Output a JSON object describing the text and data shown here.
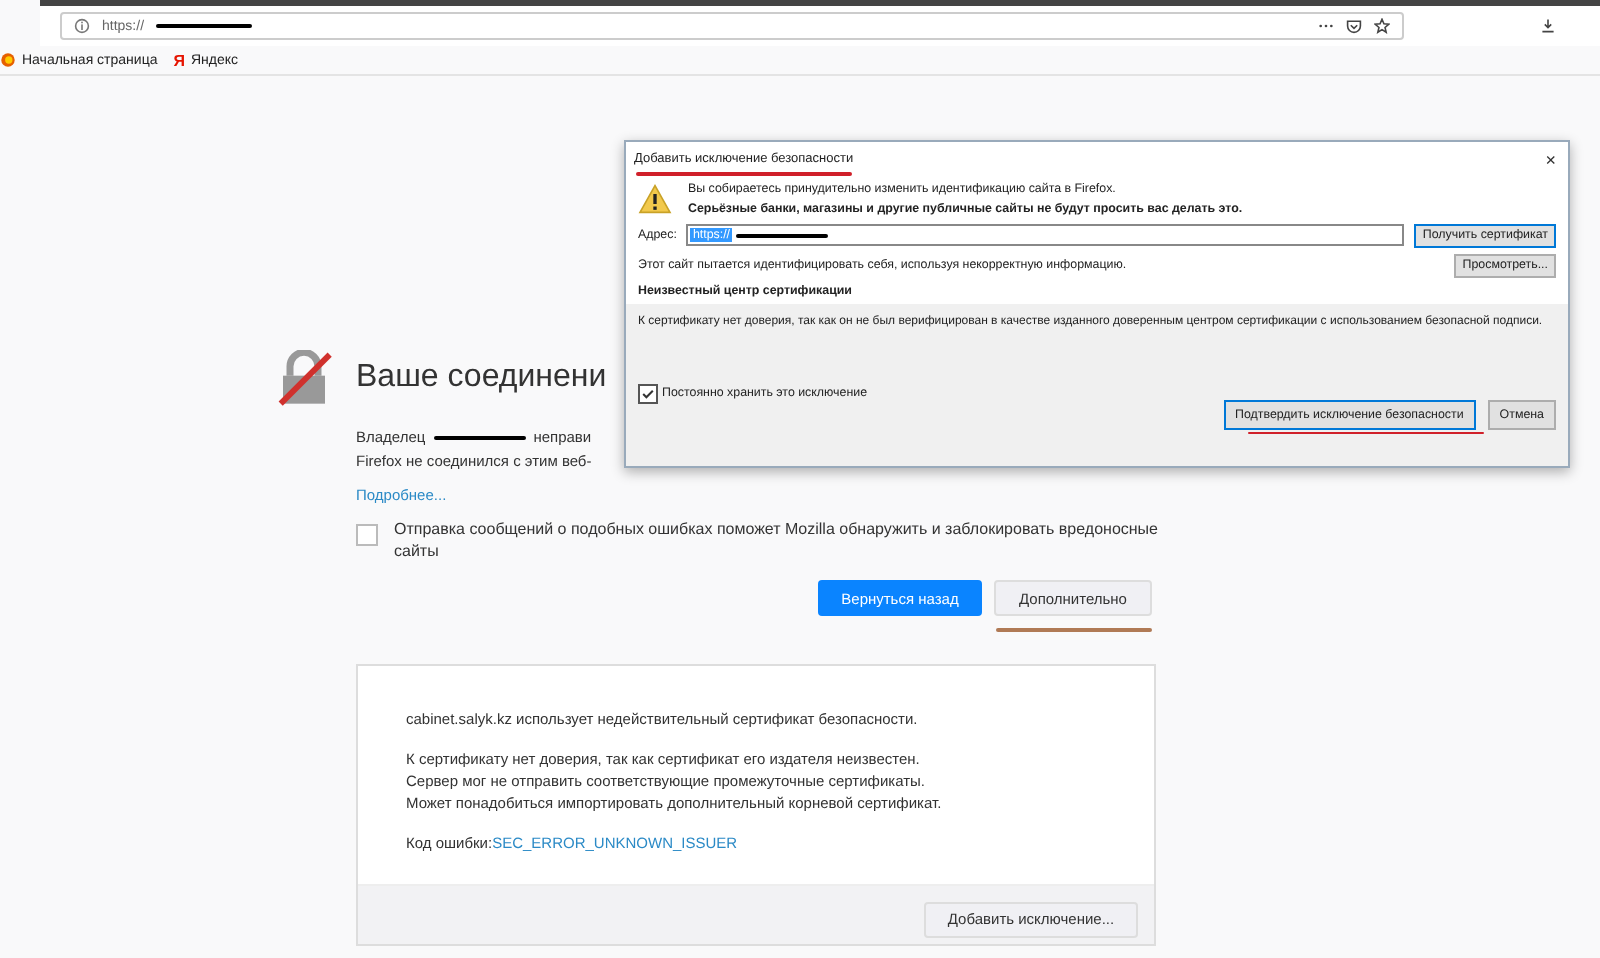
{
  "browser": {
    "url": "https://",
    "bookmarks": [
      {
        "label": "Начальная страница",
        "kind": "firefox"
      },
      {
        "label": "Яндекс",
        "kind": "yandex",
        "glyph": "Я"
      }
    ]
  },
  "error_page": {
    "title": "Ваше соединени",
    "owner_label": "Владелец",
    "owner_rest": "неправи",
    "line_2": "Firefox не соединился с этим веб-",
    "more_link": "Подробнее...",
    "report": {
      "label": "Отправка сообщений о подобных ошибках поможет Mozilla обнаружить и заблокировать вредоносные сайты",
      "checked": false
    },
    "back_button": "Вернуться назад",
    "advanced_button": "Дополнительно",
    "advanced": {
      "intro": "cabinet.salyk.kz использует недействительный сертификат безопасности.",
      "lines": [
        "К сертификату нет доверия, так как сертификат его издателя неизвестен.",
        "Сервер мог не отправить соответствующие промежуточные сертификаты.",
        "Может понадобиться импортировать дополнительный корневой сертификат."
      ],
      "code_label": "Код ошибки:",
      "code": "SEC_ERROR_UNKNOWN_ISSUER",
      "add_button": "Добавить исключение..."
    }
  },
  "dialog": {
    "title": "Добавить исключение безопасности",
    "close": "×",
    "warning": "Вы собираетесь принудительно изменить идентификацию сайта в Firefox.",
    "warning_bold": "Серьёзные банки, магазины и другие публичные сайты не будут просить вас делать это.",
    "address_label": "Адрес:",
    "address_value": "https://",
    "get_button": "Получить сертификат",
    "status": "Этот сайт пытается идентифицировать себя, используя некорректную информацию.",
    "view_button": "Просмотреть...",
    "section_title": "Неизвестный центр сертификации",
    "section_text": "К сертификату нет доверия, так как он не был верифицирован в качестве изданного доверенным центром сертификации с использованием безопасной подписи.",
    "permanent": {
      "label": "Постоянно хранить это исключение",
      "checked": true
    },
    "confirm_button": "Подтвердить исключение безопасности",
    "cancel_button": "Отмена"
  }
}
